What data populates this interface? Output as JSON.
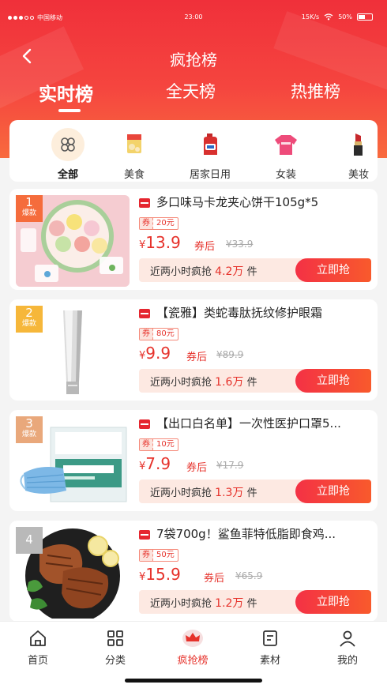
{
  "status": {
    "carrier": "中国移动",
    "time": "23:00",
    "speed": "15K/s",
    "battery": "50%"
  },
  "nav": {
    "title": "疯抢榜"
  },
  "tabs": [
    {
      "label": "实时榜"
    },
    {
      "label": "全天榜"
    },
    {
      "label": "热推榜"
    }
  ],
  "categories": [
    {
      "label": "全部"
    },
    {
      "label": "美食"
    },
    {
      "label": "居家日用"
    },
    {
      "label": "女装"
    },
    {
      "label": "美妆"
    }
  ],
  "products": [
    {
      "rank": "1",
      "rank_tag": "爆款",
      "title": "多口味马卡龙夹心饼干105g*5",
      "coupon_tag": "券",
      "coupon": "20元",
      "currency": "¥",
      "price": "13.9",
      "after": "券后",
      "orig": "¥33.9",
      "sold_prefix": "近两小时疯抢",
      "sold": "4.2万",
      "sold_suffix": "件",
      "buy": "立即抢"
    },
    {
      "rank": "2",
      "rank_tag": "爆款",
      "title": "【瓷雅】类蛇毒肽抚纹修护眼霜",
      "coupon_tag": "券",
      "coupon": "80元",
      "currency": "¥",
      "price": "9.9",
      "after": "券后",
      "orig": "¥89.9",
      "sold_prefix": "近两小时疯抢",
      "sold": "1.6万",
      "sold_suffix": "件",
      "buy": "立即抢"
    },
    {
      "rank": "3",
      "rank_tag": "爆款",
      "title": "【出口白名单】一次性医护口罩5...",
      "coupon_tag": "券",
      "coupon": "10元",
      "currency": "¥",
      "price": "7.9",
      "after": "券后",
      "orig": "¥17.9",
      "sold_prefix": "近两小时疯抢",
      "sold": "1.3万",
      "sold_suffix": "件",
      "buy": "立即抢"
    },
    {
      "rank": "4",
      "rank_tag": "",
      "title": "7袋700g！鲨鱼菲特低脂即食鸡...",
      "coupon_tag": "券",
      "coupon": "50元",
      "currency": "¥",
      "price": "15.9",
      "after": "券后",
      "orig": "¥65.9",
      "sold_prefix": "近两小时疯抢",
      "sold": "1.2万",
      "sold_suffix": "件",
      "buy": "立即抢"
    }
  ],
  "bottom_nav": [
    {
      "label": "首页",
      "icon": "home-icon"
    },
    {
      "label": "分类",
      "icon": "grid-icon"
    },
    {
      "label": "疯抢榜",
      "icon": "crown-icon"
    },
    {
      "label": "素材",
      "icon": "material-icon"
    },
    {
      "label": "我的",
      "icon": "user-icon"
    }
  ],
  "colors": {
    "accent": "#e6322b",
    "header": "#f0303a",
    "buy_gradient_start": "#f43145",
    "buy_gradient_end": "#f85a2c"
  }
}
